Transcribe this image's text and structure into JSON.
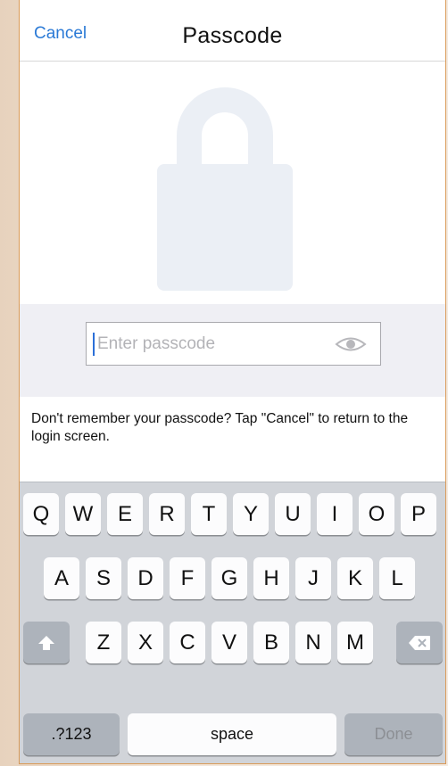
{
  "nav": {
    "cancel_label": "Cancel",
    "title": "Passcode"
  },
  "passcode": {
    "placeholder": "Enter passcode",
    "value": ""
  },
  "help": {
    "text": "Don't remember your passcode? Tap \"Cancel\" to return to the login screen."
  },
  "keyboard": {
    "row1": [
      "Q",
      "W",
      "E",
      "R",
      "T",
      "Y",
      "U",
      "I",
      "O",
      "P"
    ],
    "row2": [
      "A",
      "S",
      "D",
      "F",
      "G",
      "H",
      "J",
      "K",
      "L"
    ],
    "row3": [
      "Z",
      "X",
      "C",
      "V",
      "B",
      "N",
      "M"
    ],
    "numbers_label": ".?123",
    "space_label": "space",
    "done_label": "Done"
  },
  "colors": {
    "accent": "#2b7ad6",
    "keyboard_bg": "#d1d4d9",
    "band_bg": "#efeff4"
  },
  "icons": {
    "lock": "lock-icon",
    "eye": "eye-icon",
    "shift": "shift-icon",
    "delete": "delete-icon"
  }
}
